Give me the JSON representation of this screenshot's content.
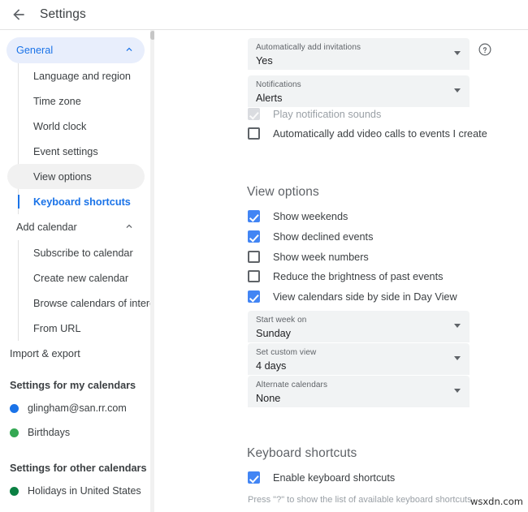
{
  "header": {
    "back_icon": "arrow-left-icon",
    "title": "Settings"
  },
  "sidebar": {
    "groups": [
      {
        "label": "General",
        "state": "expanded",
        "chevron": "chevron-up-icon",
        "active": true,
        "items": [
          {
            "label": "Language and region",
            "state": "normal"
          },
          {
            "label": "Time zone",
            "state": "normal"
          },
          {
            "label": "World clock",
            "state": "normal"
          },
          {
            "label": "Event settings",
            "state": "normal"
          },
          {
            "label": "View options",
            "state": "hovered"
          },
          {
            "label": "Keyboard shortcuts",
            "state": "selected"
          }
        ]
      },
      {
        "label": "Add calendar",
        "state": "expanded",
        "chevron": "chevron-up-icon",
        "active": false,
        "items": [
          {
            "label": "Subscribe to calendar",
            "state": "normal"
          },
          {
            "label": "Create new calendar",
            "state": "normal"
          },
          {
            "label": "Browse calendars of interest",
            "state": "normal"
          },
          {
            "label": "From URL",
            "state": "normal"
          }
        ]
      }
    ],
    "import_export": "Import & export",
    "my_calendars_title": "Settings for my calendars",
    "my_calendars": [
      {
        "label": "glingham@san.rr.com",
        "color": "#1a73e8"
      },
      {
        "label": "Birthdays",
        "color": "#34a853"
      }
    ],
    "other_calendars_title": "Settings for other calendars",
    "other_calendars": [
      {
        "label": "Holidays in United States",
        "color": "#0b8043"
      }
    ]
  },
  "main": {
    "top_fields": [
      {
        "label": "Automatically add invitations",
        "value": "Yes",
        "arrow": "chevron-down-icon"
      },
      {
        "label": "Notifications",
        "value": "Alerts",
        "arrow": "chevron-down-icon"
      }
    ],
    "help_icon": "help-circle-icon",
    "top_checkboxes": [
      {
        "label": "Play notification sounds",
        "checked": true,
        "disabled": true
      },
      {
        "label": "Automatically add video calls to events I create",
        "checked": false,
        "disabled": false
      }
    ],
    "view_options": {
      "heading": "View options",
      "checkboxes": [
        {
          "label": "Show weekends",
          "checked": true,
          "disabled": false
        },
        {
          "label": "Show declined events",
          "checked": true,
          "disabled": false
        },
        {
          "label": "Show week numbers",
          "checked": false,
          "disabled": false
        },
        {
          "label": "Reduce the brightness of past events",
          "checked": false,
          "disabled": false
        },
        {
          "label": "View calendars side by side in Day View",
          "checked": true,
          "disabled": false
        }
      ],
      "fields": [
        {
          "label": "Start week on",
          "value": "Sunday",
          "arrow": "chevron-down-icon"
        },
        {
          "label": "Set custom view",
          "value": "4 days",
          "arrow": "chevron-down-icon"
        },
        {
          "label": "Alternate calendars",
          "value": "None",
          "arrow": "chevron-down-icon"
        }
      ]
    },
    "keyboard_shortcuts": {
      "heading": "Keyboard shortcuts",
      "checkbox": {
        "label": "Enable keyboard shortcuts",
        "checked": true,
        "disabled": false
      },
      "hint": "Press \"?\" to show the list of available keyboard shortcuts"
    }
  },
  "watermark": "wsxdn.com",
  "colors": {
    "accent": "#1a73e8",
    "checkbox_checked": "#4285f4",
    "field_bg": "#f1f3f4",
    "active_pill": "#e8eefc",
    "hover_pill": "#f1f1f1"
  }
}
